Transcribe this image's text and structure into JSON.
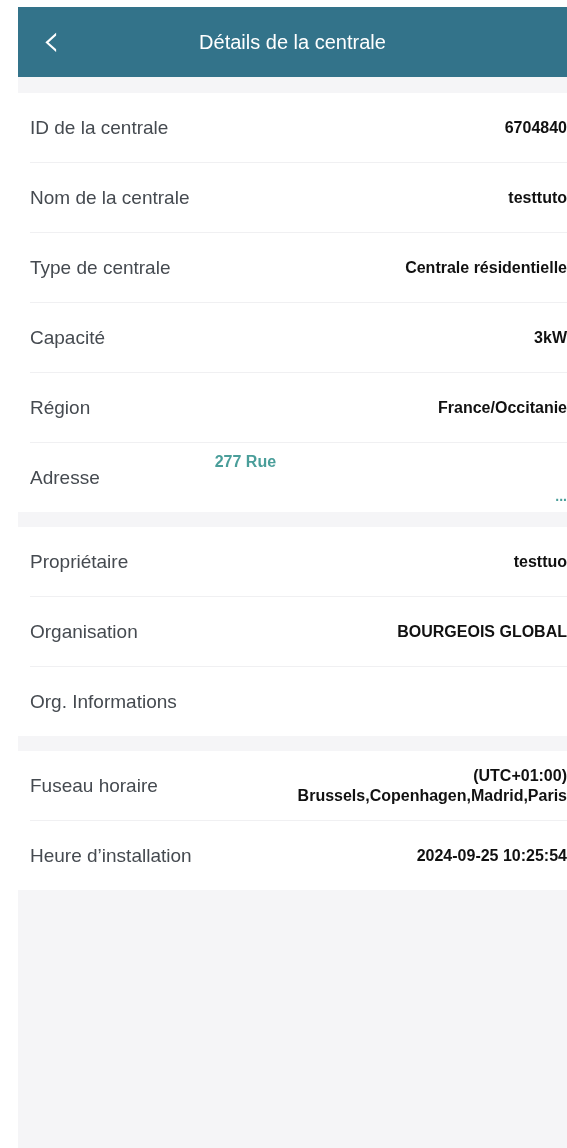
{
  "header": {
    "back": "‹",
    "title": "Détails de la centrale"
  },
  "groups": [
    {
      "rows": [
        {
          "label": "ID de la centrale",
          "kind": "plain",
          "value": "6704840"
        },
        {
          "label": "Nom de la centrale",
          "kind": "plain",
          "value": "testtuto"
        },
        {
          "label": "Type de centrale",
          "kind": "plain",
          "value": "Centrale résidentielle"
        },
        {
          "label": "Capacité",
          "kind": "plain",
          "value": "3kW"
        },
        {
          "label": "Région",
          "kind": "plain",
          "value": "France/Occitanie"
        },
        {
          "label": "Adresse",
          "kind": "link",
          "value": "277 Rue",
          "more": "..."
        }
      ]
    },
    {
      "rows": [
        {
          "label": "Propriétaire",
          "kind": "plain",
          "value": "testtuo"
        },
        {
          "label": "Organisation",
          "kind": "plain",
          "value": "BOURGEOIS GLOBAL"
        },
        {
          "label": "Org. Informations",
          "kind": "plain"
        }
      ]
    },
    {
      "rows": [
        {
          "label": "Fuseau horaire",
          "kind": "multi",
          "value_lines": [
            "(UTC+01:00)",
            "Brussels,Copenhagen,Madrid,Paris"
          ]
        },
        {
          "label": "Heure d’installation",
          "kind": "plain",
          "value": "2024-09-25 10:25:54"
        }
      ]
    }
  ]
}
